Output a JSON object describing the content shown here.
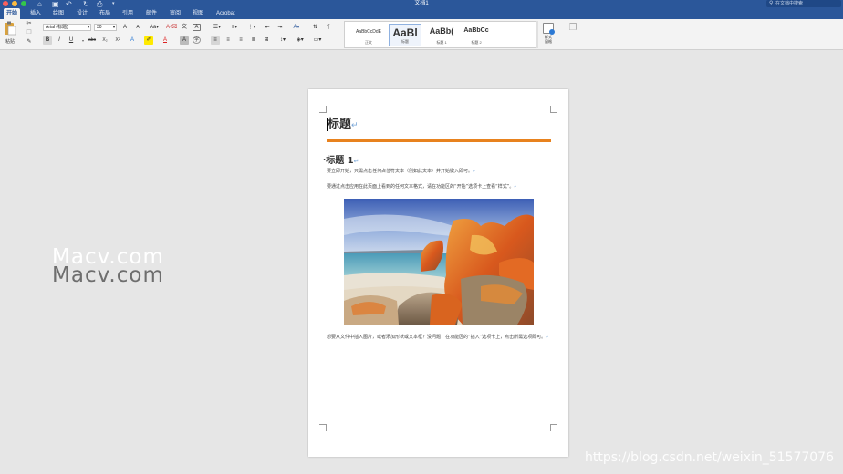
{
  "window": {
    "title": "文档1",
    "search_placeholder": "在文档中搜索",
    "traffic_colors": [
      "#fc605c",
      "#fdbc40",
      "#34c84a"
    ]
  },
  "quick_access": [
    "home-icon",
    "save-icon",
    "undo-icon",
    "redo-icon",
    "print-icon",
    "customize-icon"
  ],
  "tabs": [
    {
      "label": "开始",
      "active": true
    },
    {
      "label": "插入"
    },
    {
      "label": "绘图"
    },
    {
      "label": "设计"
    },
    {
      "label": "布局"
    },
    {
      "label": "引用"
    },
    {
      "label": "邮件"
    },
    {
      "label": "审阅"
    },
    {
      "label": "视图"
    },
    {
      "label": "Acrobat"
    }
  ],
  "ribbon": {
    "paste_label": "粘贴",
    "font_name": "Arial (标题)",
    "font_size": "30",
    "grow_font": "A",
    "shrink_font": "A",
    "bold": "B",
    "italic": "I",
    "underline": "U",
    "strike": "abc",
    "subscript": "X₂",
    "superscript": "X²",
    "styles": [
      {
        "sample": "AaBbCcDdE",
        "name": "正文"
      },
      {
        "sample": "AaBl",
        "name": "标题",
        "selected": true
      },
      {
        "sample": "AaBb(",
        "name": "标题 1"
      },
      {
        "sample": "AaBbCc",
        "name": "标题 2"
      }
    ],
    "styles_pane_label_1": "样式",
    "styles_pane_label_2": "窗格"
  },
  "document": {
    "title": "标题",
    "heading1": "标题 1",
    "para1": "要立即开始，只需点击任何占位符文本（例如此文本）并开始键入即可。",
    "para2": "要通过点击应用在此页面上看到的任何文本格式，请在功能区的“开始”选项卡上查看“样式”。",
    "para3": "想要从文件中插入图片，或者添加形状或文本框？没问题！在功能区的“插入”选项卡上，点击所需选项即可。",
    "para_mark": "↵",
    "accent_color": "#e8821e"
  },
  "watermark": {
    "line1": "Macv.com",
    "line2": "Macv.com",
    "corner": "https://blog.csdn.net/weixin_51577076"
  }
}
